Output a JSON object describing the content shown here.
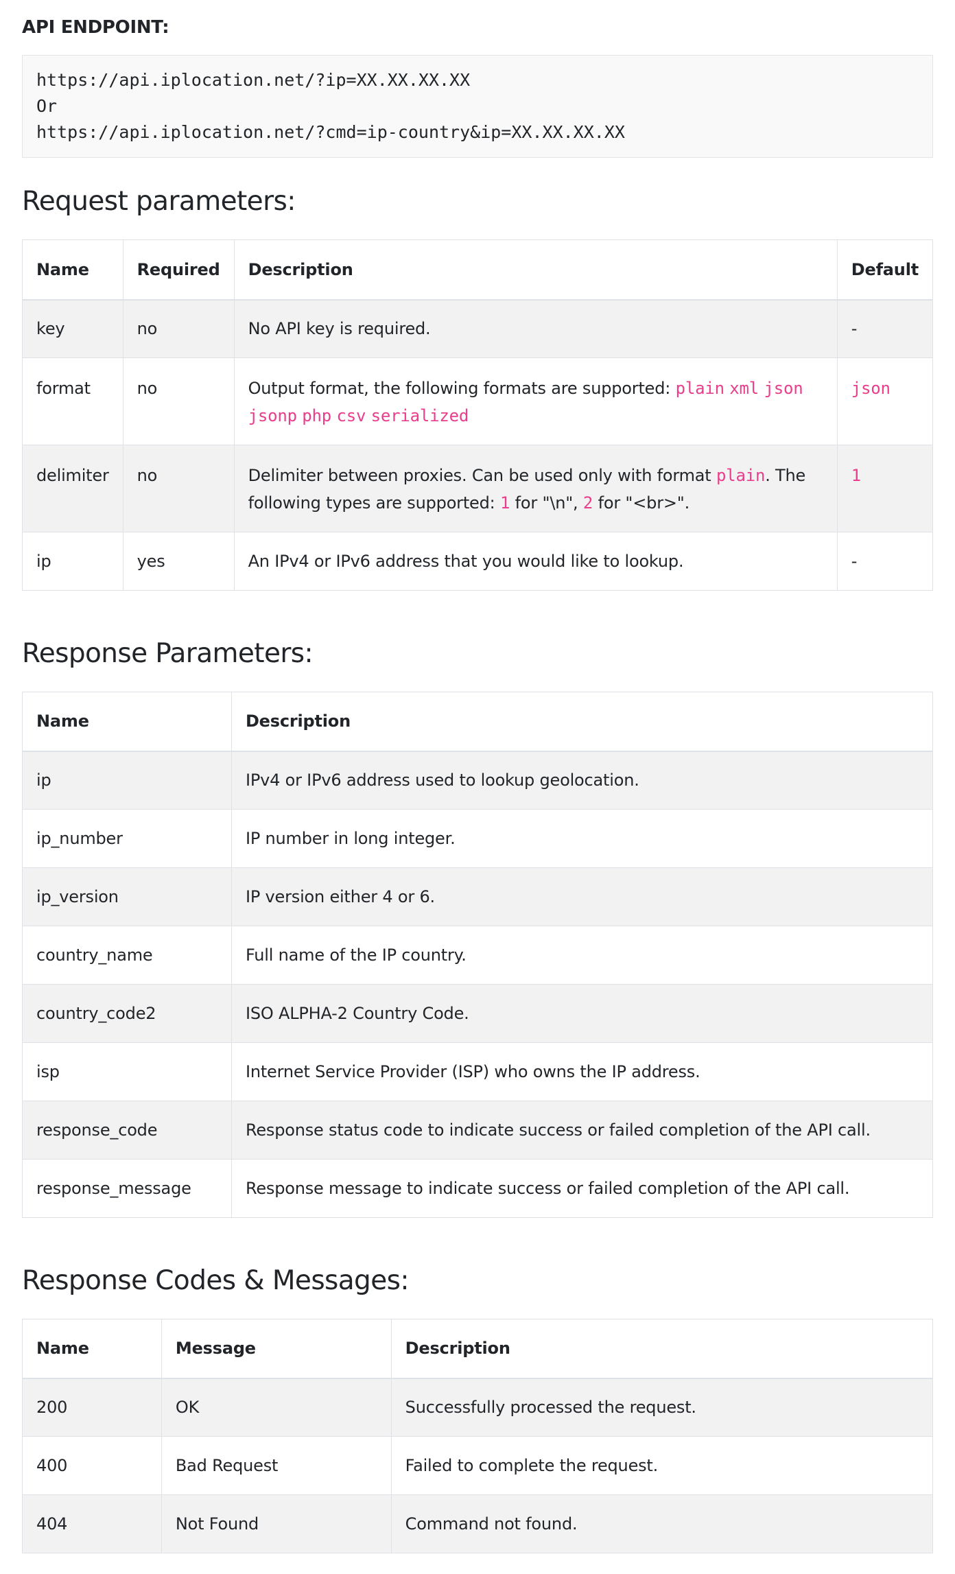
{
  "endpoint": {
    "label": "API ENDPOINT:",
    "lines": [
      "https://api.iplocation.net/?ip=XX.XX.XX.XX",
      "Or",
      "https://api.iplocation.net/?cmd=ip-country&ip=XX.XX.XX.XX"
    ]
  },
  "request": {
    "title": "Request parameters:",
    "headers": [
      "Name",
      "Required",
      "Description",
      "Default"
    ],
    "rows": [
      {
        "name": "key",
        "required": "no",
        "description": "No API key is required.",
        "default": "-"
      },
      {
        "name": "format",
        "required": "no",
        "description_prefix": "Output format, the following formats are supported: ",
        "formats": [
          "plain",
          "xml",
          "json",
          "jsonp",
          "php",
          "csv",
          "serialized"
        ],
        "default": "json"
      },
      {
        "name": "delimiter",
        "required": "no",
        "description_parts": [
          "Delimiter between proxies. Can be used only with format ",
          "plain",
          ". The following types are supported: ",
          "1",
          " for \"\\n\", ",
          "2",
          " for \"<br>\"."
        ],
        "default": "1"
      },
      {
        "name": "ip",
        "required": "yes",
        "description": "An IPv4 or IPv6 address that you would like to lookup.",
        "default": "-"
      }
    ]
  },
  "response": {
    "title": "Response Parameters:",
    "headers": [
      "Name",
      "Description"
    ],
    "rows": [
      {
        "name": "ip",
        "description": "IPv4 or IPv6 address used to lookup geolocation."
      },
      {
        "name": "ip_number",
        "description": "IP number in long integer."
      },
      {
        "name": "ip_version",
        "description": "IP version either 4 or 6."
      },
      {
        "name": "country_name",
        "description": "Full name of the IP country."
      },
      {
        "name": "country_code2",
        "description": "ISO ALPHA-2 Country Code."
      },
      {
        "name": "isp",
        "description": "Internet Service Provider (ISP) who owns the IP address."
      },
      {
        "name": "response_code",
        "description": "Response status code to indicate success or failed completion of the API call."
      },
      {
        "name": "response_message",
        "description": "Response message to indicate success or failed completion of the API call."
      }
    ]
  },
  "codes": {
    "title": "Response Codes & Messages:",
    "headers": [
      "Name",
      "Message",
      "Description"
    ],
    "rows": [
      {
        "name": "200",
        "message": "OK",
        "description": "Successfully processed the request."
      },
      {
        "name": "400",
        "message": "Bad Request",
        "description": "Failed to complete the request."
      },
      {
        "name": "404",
        "message": "Not Found",
        "description": "Command not found."
      }
    ]
  },
  "colors": {
    "code_accent": "#e83e8c",
    "stripe": "#f2f2f2",
    "border": "#dee2e6"
  }
}
